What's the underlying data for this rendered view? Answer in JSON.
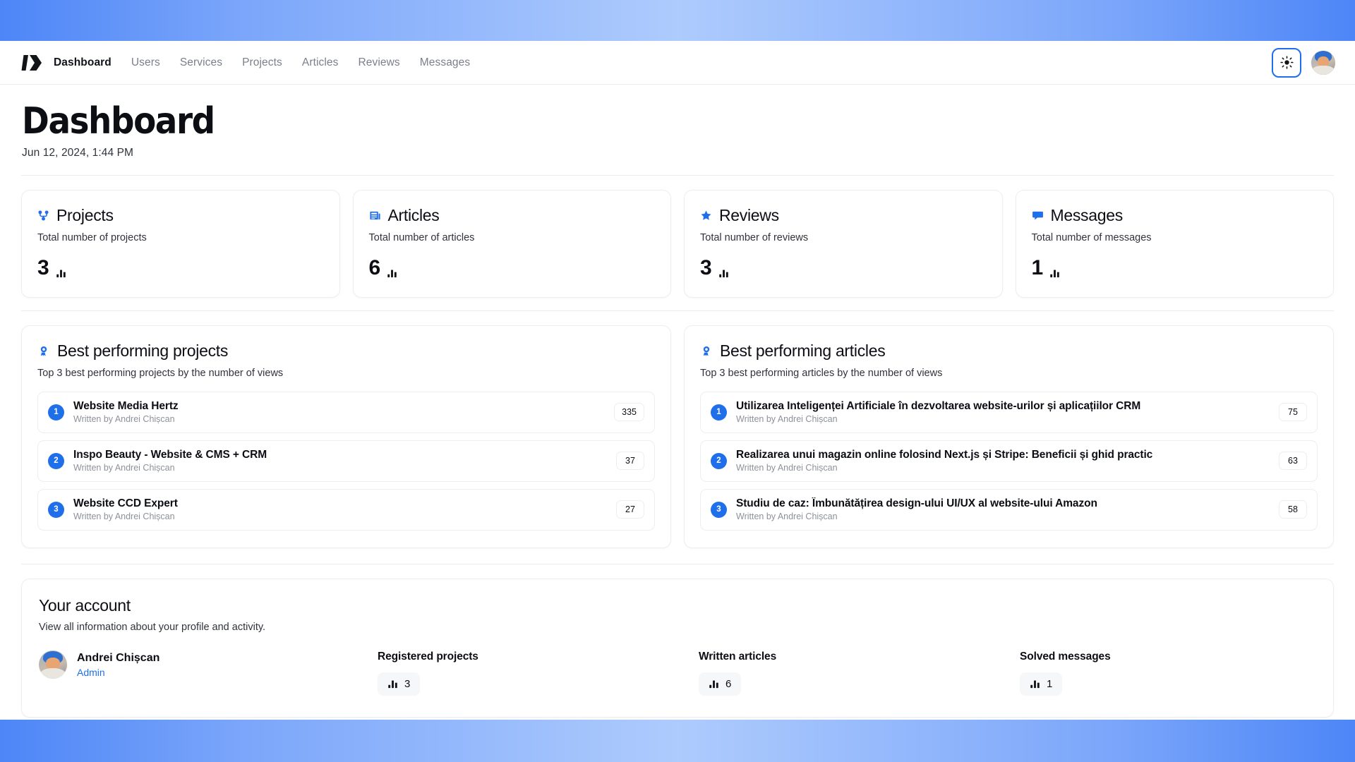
{
  "brand": {
    "logo_icon": "play-arrow-logo"
  },
  "nav": {
    "items": [
      {
        "label": "Dashboard",
        "active": true
      },
      {
        "label": "Users",
        "active": false
      },
      {
        "label": "Services",
        "active": false
      },
      {
        "label": "Projects",
        "active": false
      },
      {
        "label": "Articles",
        "active": false
      },
      {
        "label": "Reviews",
        "active": false
      },
      {
        "label": "Messages",
        "active": false
      }
    ],
    "theme_toggle_icon": "sun-icon",
    "avatar_alt": "Andrei Chișcan"
  },
  "page": {
    "title": "Dashboard",
    "date": "Jun 12, 2024, 1:44 PM"
  },
  "stats": [
    {
      "icon": "git-branch-icon",
      "name": "Projects",
      "subtitle": "Total number of projects",
      "value": "3",
      "value_icon": "bar-chart-icon"
    },
    {
      "icon": "article-icon",
      "name": "Articles",
      "subtitle": "Total number of articles",
      "value": "6",
      "value_icon": "bar-chart-icon"
    },
    {
      "icon": "star-icon",
      "name": "Reviews",
      "subtitle": "Total number of reviews",
      "value": "3",
      "value_icon": "bar-chart-icon"
    },
    {
      "icon": "message-icon",
      "name": "Messages",
      "subtitle": "Total number of messages",
      "value": "1",
      "value_icon": "bar-chart-icon"
    }
  ],
  "best_projects": {
    "icon": "award-icon",
    "title": "Best performing projects",
    "subtitle": "Top 3 best performing projects by the number of views",
    "items": [
      {
        "rank": "1",
        "title": "Website Media Hertz",
        "author": "Written by Andrei Chișcan",
        "views": "335"
      },
      {
        "rank": "2",
        "title": "Inspo Beauty - Website & CMS + CRM",
        "author": "Written by Andrei Chișcan",
        "views": "37"
      },
      {
        "rank": "3",
        "title": "Website CCD Expert",
        "author": "Written by Andrei Chișcan",
        "views": "27"
      }
    ]
  },
  "best_articles": {
    "icon": "award-icon",
    "title": "Best performing articles",
    "subtitle": "Top 3 best performing articles by the number of views",
    "items": [
      {
        "rank": "1",
        "title": "Utilizarea Inteligenței Artificiale în dezvoltarea website-urilor și aplicațiilor CRM",
        "author": "Written by Andrei Chișcan",
        "views": "75"
      },
      {
        "rank": "2",
        "title": "Realizarea unui magazin online folosind Next.js și Stripe: Beneficii și ghid practic",
        "author": "Written by Andrei Chișcan",
        "views": "63"
      },
      {
        "rank": "3",
        "title": "Studiu de caz: Îmbunătățirea design-ului UI/UX al website-ului Amazon",
        "author": "Written by Andrei Chișcan",
        "views": "58"
      }
    ]
  },
  "account": {
    "title": "Your account",
    "subtitle": "View all information about your profile and activity.",
    "user_name": "Andrei Chișcan",
    "user_role": "Admin",
    "metrics": [
      {
        "label": "Registered projects",
        "value": "3",
        "icon": "bar-chart-icon"
      },
      {
        "label": "Written articles",
        "value": "6",
        "icon": "bar-chart-icon"
      },
      {
        "label": "Solved messages",
        "value": "1",
        "icon": "bar-chart-icon"
      }
    ]
  },
  "colors": {
    "accent": "#1f6feb",
    "text": "#0c0e14",
    "muted": "#8d9199",
    "border": "#eceef1",
    "gradient_edge": "#4d86f7",
    "gradient_center": "#aecbfd"
  }
}
